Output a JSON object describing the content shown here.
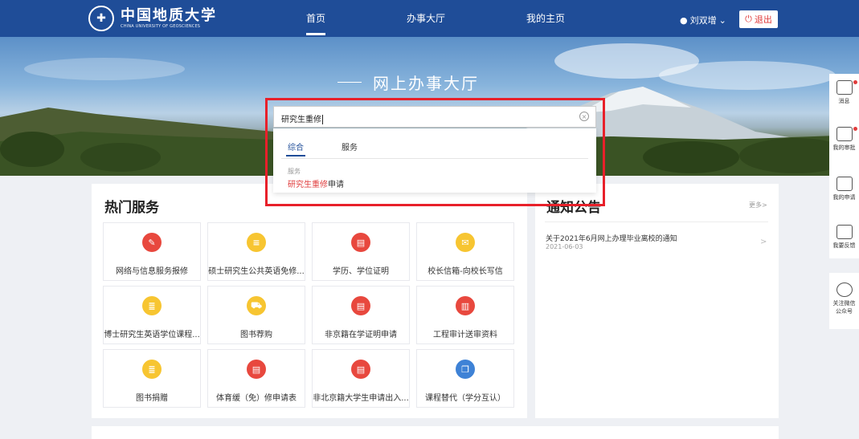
{
  "header": {
    "logo_cn": "中国地质大学",
    "logo_en": "CHINA UNIVERSITY OF GEOSCIENCES",
    "nav": [
      "首页",
      "办事大厅",
      "我的主页"
    ],
    "user_name": "刘双增",
    "logout_label": "退出"
  },
  "banner": {
    "title": "网上办事大厅"
  },
  "search": {
    "value": "研究生重修",
    "tabs": [
      "综合",
      "服务"
    ],
    "result_category": "服务",
    "result_highlight": "研究生重修",
    "result_rest": "申请"
  },
  "hot_services": {
    "title": "热门服务",
    "items": [
      {
        "label": "网络与信息服务报修",
        "color": "#e8483e",
        "icon": "edit-icon"
      },
      {
        "label": "硕士研究生公共英语免修...",
        "color": "#f7c531",
        "icon": "document-icon"
      },
      {
        "label": "学历、学位证明",
        "color": "#e8483e",
        "icon": "certificate-icon"
      },
      {
        "label": "校长信箱-向校长写信",
        "color": "#f7c531",
        "icon": "mail-icon"
      },
      {
        "label": "博士研究生英语学位课程...",
        "color": "#f7c531",
        "icon": "notepad-icon"
      },
      {
        "label": "图书荐购",
        "color": "#f7c531",
        "icon": "cart-icon"
      },
      {
        "label": "非京籍在学证明申请",
        "color": "#e8483e",
        "icon": "certificate-icon"
      },
      {
        "label": "工程审计送审资料",
        "color": "#e8483e",
        "icon": "clipboard-icon"
      },
      {
        "label": "图书捐赠",
        "color": "#f7c531",
        "icon": "notepad-icon"
      },
      {
        "label": "体育缓（免）修申请表",
        "color": "#e8483e",
        "icon": "certificate-icon"
      },
      {
        "label": "非北京籍大学生申请出入...",
        "color": "#e8483e",
        "icon": "certificate-icon"
      },
      {
        "label": "课程替代（学分互认）",
        "color": "#3e82d6",
        "icon": "book-icon"
      }
    ]
  },
  "notices": {
    "title": "通知公告",
    "more": "更多>",
    "items": [
      {
        "title": "关于2021年6月网上办理毕业离校的通知",
        "date": "2021-06-03"
      }
    ]
  },
  "sidebar": {
    "items": [
      "消息",
      "我的审批",
      "我的申请",
      "我要反馈"
    ],
    "wechat": [
      "关注微信",
      "公众号"
    ]
  }
}
